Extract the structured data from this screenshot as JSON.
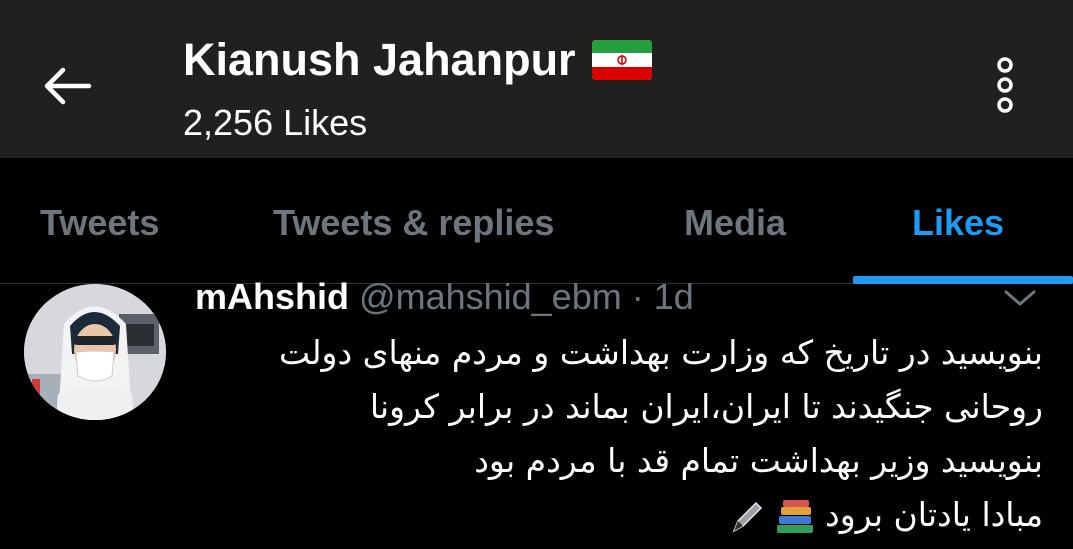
{
  "header": {
    "back_icon": "arrow-left-icon",
    "profile_name": "Kianush Jahanpur",
    "flag_icon": "iran-flag-icon",
    "likes_count": "2,256 Likes",
    "menu_icon": "more-vertical-icon"
  },
  "tabs": [
    {
      "label": "Tweets",
      "active": false
    },
    {
      "label": "Tweets & replies",
      "active": false
    },
    {
      "label": "Media",
      "active": false
    },
    {
      "label": "Likes",
      "active": true
    }
  ],
  "tweet": {
    "author_name": "mAhshid",
    "author_handle": "@mahshid_ebm",
    "separator": "·",
    "time": "1d",
    "caret_icon": "chevron-down-icon",
    "lines": [
      "بنویسید در تاریخ که وزارت بهداشت و مردم منهای دولت",
      "روحانی جنگیدند تا ایران،ایران بماند در برابر کرونا",
      "بنویسید وزیر بهداشت تمام قد با مردم بود",
      "مبادا یادتان برود"
    ],
    "emoji_icons": [
      "books-icon",
      "pen-icon"
    ]
  },
  "colors": {
    "header_bg": "#221f1f",
    "accent": "#1d9bf0",
    "muted": "#6e767d"
  }
}
